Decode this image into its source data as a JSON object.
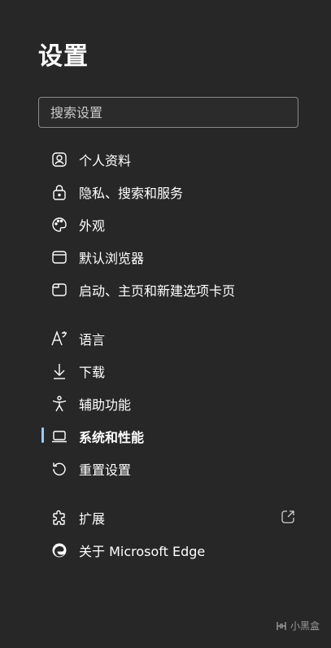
{
  "header": {
    "title": "设置"
  },
  "search": {
    "placeholder": "搜索设置"
  },
  "nav": {
    "items": [
      {
        "label": "个人资料",
        "icon": "profile-icon"
      },
      {
        "label": "隐私、搜索和服务",
        "icon": "lock-icon"
      },
      {
        "label": "外观",
        "icon": "palette-icon"
      },
      {
        "label": "默认浏览器",
        "icon": "browser-window-icon"
      },
      {
        "label": "启动、主页和新建选项卡页",
        "icon": "start-page-icon"
      },
      {
        "label": "语言",
        "icon": "language-icon"
      },
      {
        "label": "下载",
        "icon": "download-icon"
      },
      {
        "label": "辅助功能",
        "icon": "accessibility-icon"
      },
      {
        "label": "系统和性能",
        "icon": "laptop-icon",
        "active": true
      },
      {
        "label": "重置设置",
        "icon": "reset-icon"
      },
      {
        "label": "扩展",
        "icon": "puzzle-icon"
      },
      {
        "label": "关于 Microsoft Edge",
        "icon": "edge-logo-icon"
      }
    ]
  },
  "watermark": {
    "label": "小黑盒"
  },
  "colors": {
    "background": "#272727",
    "active_indicator": "#9ecbf5",
    "text": "#ffffff"
  }
}
